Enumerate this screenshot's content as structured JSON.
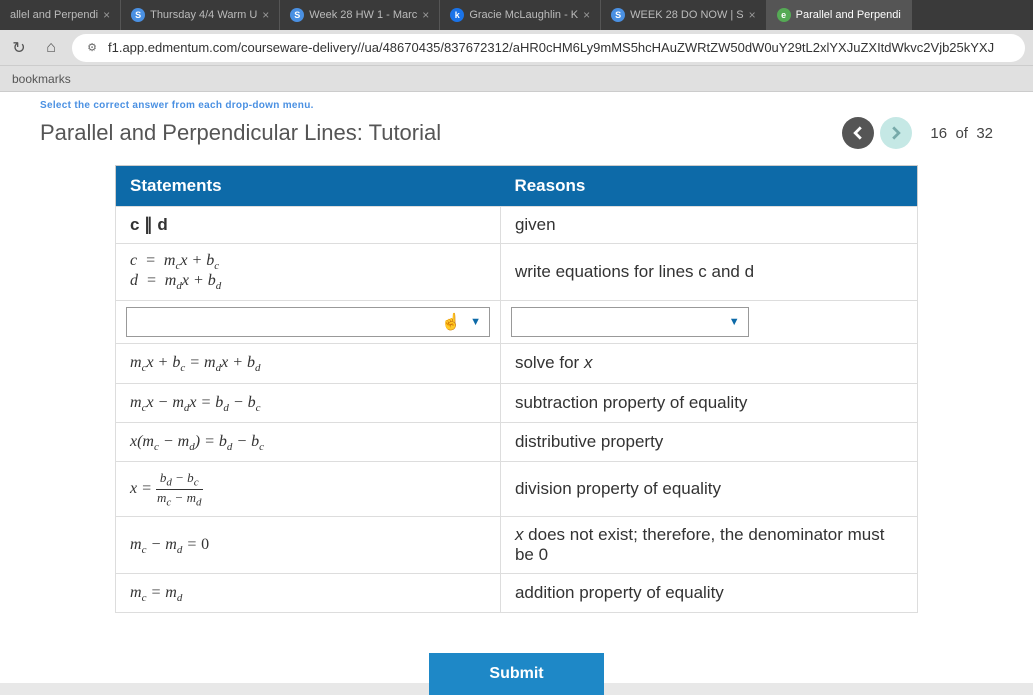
{
  "tabs": [
    {
      "label": "allel and Perpendi",
      "icon": ""
    },
    {
      "label": "Thursday 4/4 Warm U",
      "icon": "S"
    },
    {
      "label": "Week 28 HW 1 - Marc",
      "icon": "S"
    },
    {
      "label": "Gracie McLaughlin - K",
      "icon": "k"
    },
    {
      "label": "WEEK 28 DO NOW | S",
      "icon": "S"
    },
    {
      "label": "Parallel and Perpendi",
      "icon": "e"
    }
  ],
  "url": "f1.app.edmentum.com/courseware-delivery//ua/48670435/837672312/aHR0cHM6Ly9mMS5hcHAuZWRtZW50dW0uY29tL2xlYXJuZXItdWkvc2Vjb25kYXJ",
  "bookmarks_label": "bookmarks",
  "prompt": "Select the correct answer from each drop-down menu.",
  "title": "Parallel and Perpendicular Lines: Tutorial",
  "pager": {
    "current": "16",
    "of": "of",
    "total": "32"
  },
  "headers": {
    "statements": "Statements",
    "reasons": "Reasons"
  },
  "rows": [
    {
      "s": "c ∥ d",
      "r": "given",
      "plain_s": true
    },
    {
      "s": "c = m_c x + b_c|d = m_d x + b_d",
      "r": "write equations for lines c and d",
      "twoline": true
    },
    {
      "dropdown": true
    },
    {
      "s": "m_c x + b_c = m_d x + b_d",
      "r": "solve for x"
    },
    {
      "s": "m_c x − m_d x = b_d − b_c",
      "r": "subtraction property of equality"
    },
    {
      "s": "x(m_c − m_d) = b_d − b_c",
      "r": "distributive property"
    },
    {
      "s": "x = (b_d − b_c)/(m_c − m_d)",
      "r": "division property of equality",
      "frac": true
    },
    {
      "s": "m_c − m_d = 0",
      "r": "x does not exist; therefore, the denominator must be 0"
    },
    {
      "s": "m_c = m_d",
      "r": "addition property of equality"
    }
  ],
  "submit": "Submit"
}
